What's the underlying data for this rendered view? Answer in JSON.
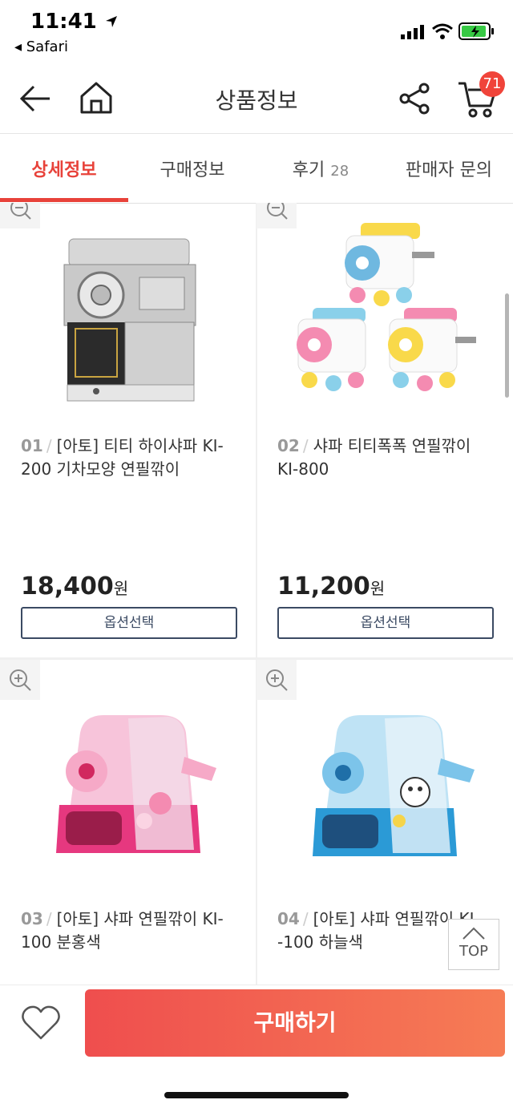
{
  "status_bar": {
    "time": "11:41",
    "back_app": "◂ Safari"
  },
  "header": {
    "title": "상품정보",
    "cart_count": "71"
  },
  "tabs": [
    {
      "label": "상세정보",
      "count": ""
    },
    {
      "label": "구매정보",
      "count": ""
    },
    {
      "label": "후기",
      "count": "28"
    },
    {
      "label": "판매자 문의",
      "count": ""
    }
  ],
  "products": [
    {
      "num": "01",
      "line1": "[아토] 티티 하이샤파 KI-",
      "line2": "200 기차모양 연필깎이",
      "price": "18,400",
      "currency": "원",
      "option_label": "옵션선택"
    },
    {
      "num": "02",
      "line1": "샤파 티티폭폭 연필깎이",
      "line2": "KI-800",
      "price": "11,200",
      "currency": "원",
      "option_label": "옵션선택"
    },
    {
      "num": "03",
      "line1": "[아토] 샤파 연필깎이 KI-",
      "line2": "100 분홍색"
    },
    {
      "num": "04",
      "line1": "[아토] 샤파 연필깎이 KI",
      "line2": "-100 하늘색"
    }
  ],
  "top_button": "TOP",
  "buy_label": "구매하기",
  "colors": {
    "accent": "#e8423a",
    "buy_gradient_start": "#ef4e4e",
    "buy_gradient_end": "#f67c55",
    "option_border": "#3b4a63"
  },
  "icons": [
    "back-arrow-icon",
    "home-icon",
    "share-icon",
    "cart-icon",
    "zoom-icon",
    "heart-icon",
    "chevron-up-icon",
    "location-arrow-icon",
    "signal-icon",
    "wifi-icon",
    "battery-icon"
  ]
}
